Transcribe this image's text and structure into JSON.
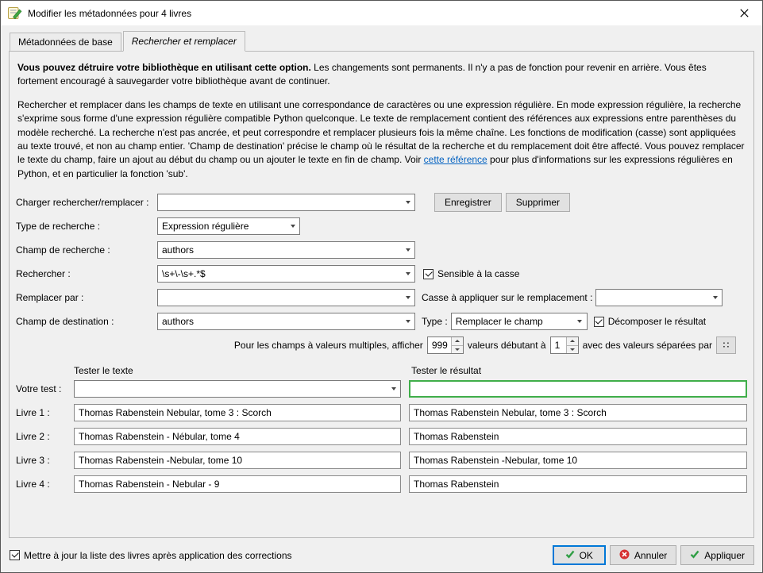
{
  "window": {
    "title": "Modifier les métadonnées pour 4 livres"
  },
  "tabs": {
    "basic": "Métadonnées de base",
    "search_replace": "Rechercher et remplacer"
  },
  "warning": {
    "bold": "Vous pouvez détruire votre bibliothèque en utilisant cette option.",
    "rest": " Les changements sont permanents. Il n'y a pas de fonction pour revenir en arrière. Vous êtes fortement encouragé à sauvegarder votre bibliothèque avant de continuer."
  },
  "description": {
    "before_link": "Rechercher et remplacer dans les champs de texte en utilisant une correspondance de caractères ou une expression régulière. En mode expression régulière, la recherche s'exprime sous forme d'une expression régulière compatible Python quelconque. Le texte de remplacement contient des références aux expressions entre parenthèses du modèle recherché. La recherche n'est pas ancrée, et peut correspondre et remplacer plusieurs fois la même chaîne. Les fonctions de modification (casse) sont appliquées au texte trouvé, et non au champ entier. 'Champ de destination' précise le champ où le résultat de la recherche et du remplacement doit être affecté. Vous pouvez remplacer le texte du champ, faire un ajout au début du champ ou un ajouter le texte en fin de champ. Voir ",
    "link": "cette référence",
    "after_link": " pour plus d'informations sur les expressions régulières en Python, et en particulier la fonction 'sub'."
  },
  "form": {
    "load": {
      "label": "Charger rechercher/remplacer :",
      "value": ""
    },
    "save_button": "Enregistrer",
    "delete_button": "Supprimer",
    "search_mode": {
      "label": "Type de recherche :",
      "value": "Expression régulière"
    },
    "search_field": {
      "label": "Champ de recherche :",
      "value": "authors"
    },
    "search_for": {
      "label": "Rechercher :",
      "value": "\\s+\\-\\s+.*$"
    },
    "case_sensitive": {
      "label": "Sensible à la casse",
      "checked": true
    },
    "replace_with": {
      "label": "Remplacer par :",
      "value": ""
    },
    "replace_func": {
      "label": "Casse à appliquer sur le remplacement :",
      "value": ""
    },
    "destination_field": {
      "label": "Champ de destination :",
      "value": "authors"
    },
    "replace_mode": {
      "label": "Type :",
      "value": "Remplacer le champ"
    },
    "split_result": {
      "label": "Décomposer le résultat",
      "checked": true
    },
    "multiple": {
      "label_show": "Pour les champs à valeurs multiples, afficher",
      "count": "999",
      "label_starting": "valeurs débutant à",
      "start": "1",
      "label_separator": "avec des valeurs séparées par",
      "separator_icon": "∷"
    }
  },
  "test": {
    "text_header": "Tester le texte",
    "result_header": "Tester le résultat",
    "your_test": {
      "label": "Votre test :",
      "text": "",
      "result": ""
    },
    "books": [
      {
        "label": "Livre 1 :",
        "text": "Thomas Rabenstein Nebular, tome 3 : Scorch",
        "result": "Thomas Rabenstein Nebular, tome 3 : Scorch"
      },
      {
        "label": "Livre 2 :",
        "text": "Thomas Rabenstein - Nébular, tome 4",
        "result": "Thomas Rabenstein"
      },
      {
        "label": "Livre 3 :",
        "text": "Thomas Rabenstein -Nebular, tome 10",
        "result": "Thomas Rabenstein -Nebular, tome 10"
      },
      {
        "label": "Livre 4 :",
        "text": "Thomas Rabenstein - Nebular - 9",
        "result": "Thomas Rabenstein"
      }
    ]
  },
  "footer": {
    "update_checkbox": "Mettre à jour la liste des livres après application des corrections",
    "ok": "OK",
    "cancel": "Annuler",
    "apply": "Appliquer"
  }
}
